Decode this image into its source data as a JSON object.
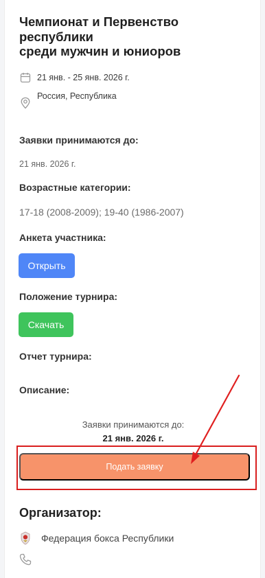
{
  "event": {
    "title_line1": "Чемпионат и Первенство",
    "title_line2": "республики",
    "title_line3": "среди мужчин и юниоров",
    "dates": "21 янв.  -  25 янв. 2026 г.",
    "location": "Россия, Республика"
  },
  "details": {
    "deadline_label": "Заявки принимаются до:",
    "deadline_value": "21 янв. 2026 г.",
    "age_label": "Возрастные категории:",
    "age_value": "17-18 (2008-2009); 19-40 (1986-2007)",
    "form_label": "Анкета участника:",
    "open_button": "Открыть",
    "regulation_label": "Положение турнира:",
    "download_button": "Скачать",
    "report_label": "Отчет турнира:",
    "description_label": "Описание:"
  },
  "footer": {
    "deadline_label": "Заявки принимаются до:",
    "deadline_date": "21 янв. 2026 г.",
    "submit_button": "Подать заявку"
  },
  "organizer": {
    "heading": "Организатор:",
    "name": "Федерация бокса Республики"
  },
  "colors": {
    "open_button": "#4f86f7",
    "download_button": "#3fc45c",
    "submit_button": "#f7936a",
    "annotation": "#d91e1e"
  },
  "icons": [
    "calendar-icon",
    "location-pin-icon",
    "federation-emblem-icon",
    "phone-icon"
  ]
}
